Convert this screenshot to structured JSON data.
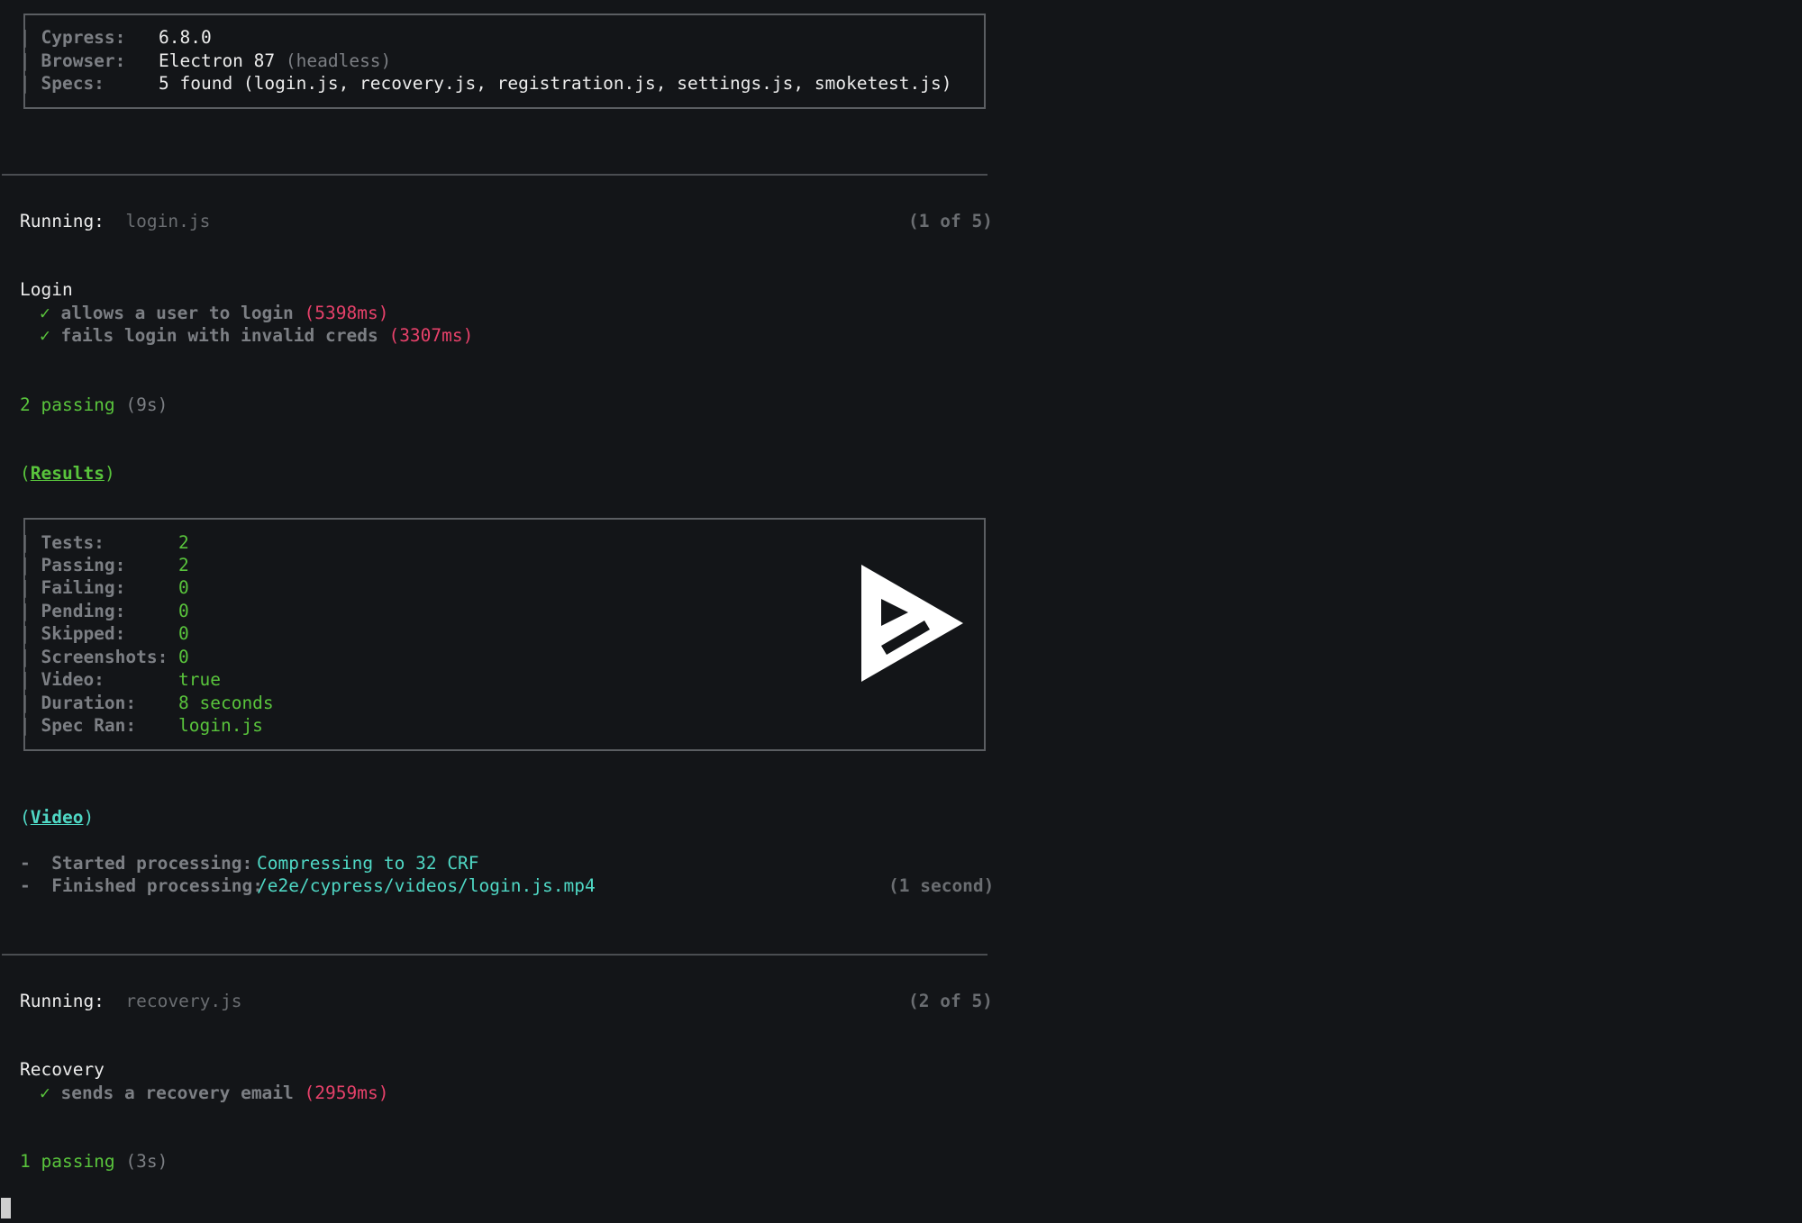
{
  "header": {
    "rows": [
      {
        "label": "Cypress:",
        "value": "6.8.0",
        "extra": ""
      },
      {
        "label": "Browser:",
        "value": "Electron 87",
        "extra": "(headless)"
      },
      {
        "label": "Specs:",
        "value": "5 found (login.js, recovery.js, registration.js, settings.js, smoketest.js)",
        "extra": ""
      }
    ]
  },
  "runs": [
    {
      "running_label": "Running:",
      "spec": "login.js",
      "counter": "(1 of 5)",
      "suite": "Login",
      "tests": [
        {
          "check": "✓",
          "title": "allows a user to login",
          "time": "(5398ms)"
        },
        {
          "check": "✓",
          "title": "fails login with invalid creds",
          "time": "(3307ms)"
        }
      ],
      "passing": "2 passing",
      "passing_time": "(9s)"
    },
    {
      "running_label": "Running:",
      "spec": "recovery.js",
      "counter": "(2 of 5)",
      "suite": "Recovery",
      "tests": [
        {
          "check": "✓",
          "title": "sends a recovery email",
          "time": "(2959ms)"
        }
      ],
      "passing": "1 passing",
      "passing_time": "(3s)"
    }
  ],
  "results": {
    "open": "(",
    "label": "Results",
    "close": ")",
    "rows": [
      {
        "label": "Tests:",
        "value": "2"
      },
      {
        "label": "Passing:",
        "value": "2"
      },
      {
        "label": "Failing:",
        "value": "0"
      },
      {
        "label": "Pending:",
        "value": "0"
      },
      {
        "label": "Skipped:",
        "value": "0"
      },
      {
        "label": "Screenshots:",
        "value": "0"
      },
      {
        "label": "Video:",
        "value": "true"
      },
      {
        "label": "Duration:",
        "value": "8 seconds"
      },
      {
        "label": "Spec Ran:",
        "value": "login.js"
      }
    ]
  },
  "video": {
    "open": "(",
    "label": "Video",
    "close": ")",
    "started_label": "-  Started processing:",
    "started_value": "Compressing to 32 CRF",
    "finished_label": "-  Finished processing:",
    "finished_value": "/e2e/cypress/videos/login.js.mp4",
    "finished_time": "(1 second)"
  },
  "colors": {
    "background": "#131518",
    "green": "#59c43c",
    "red": "#e6416a",
    "cyan": "#4fd7c4",
    "gray": "#7c7f84"
  },
  "icons": [
    "asciinema-play-logo-icon",
    "terminal-cursor"
  ]
}
